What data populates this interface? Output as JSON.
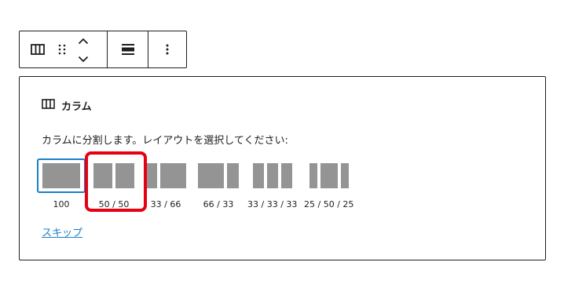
{
  "toolbar": {
    "block_icon": "columns-icon",
    "drag_icon": "drag-handle-icon",
    "move_up_icon": "chevron-up-icon",
    "move_down_icon": "chevron-down-icon",
    "align_icon": "align-wide-icon",
    "more_icon": "more-vertical-icon"
  },
  "placeholder": {
    "label": "カラム",
    "label_icon": "columns-icon",
    "instructions": "カラムに分割します。レイアウトを選択してください:",
    "variations": [
      {
        "label": "100",
        "ratios": [
          1
        ],
        "selected": true
      },
      {
        "label": "50 / 50",
        "ratios": [
          1,
          1
        ],
        "selected": false
      },
      {
        "label": "33 / 66",
        "ratios": [
          1,
          2
        ],
        "selected": false
      },
      {
        "label": "66 / 33",
        "ratios": [
          2,
          1
        ],
        "selected": false
      },
      {
        "label": "33 / 33 / 33",
        "ratios": [
          1,
          1,
          1
        ],
        "selected": false
      },
      {
        "label": "25 / 50 / 25",
        "ratios": [
          1,
          2,
          1
        ],
        "selected": false
      }
    ],
    "skip_label": "スキップ"
  },
  "colors": {
    "accent": "#1a7fc9",
    "highlight": "#e60012",
    "column_fill": "#949494"
  }
}
